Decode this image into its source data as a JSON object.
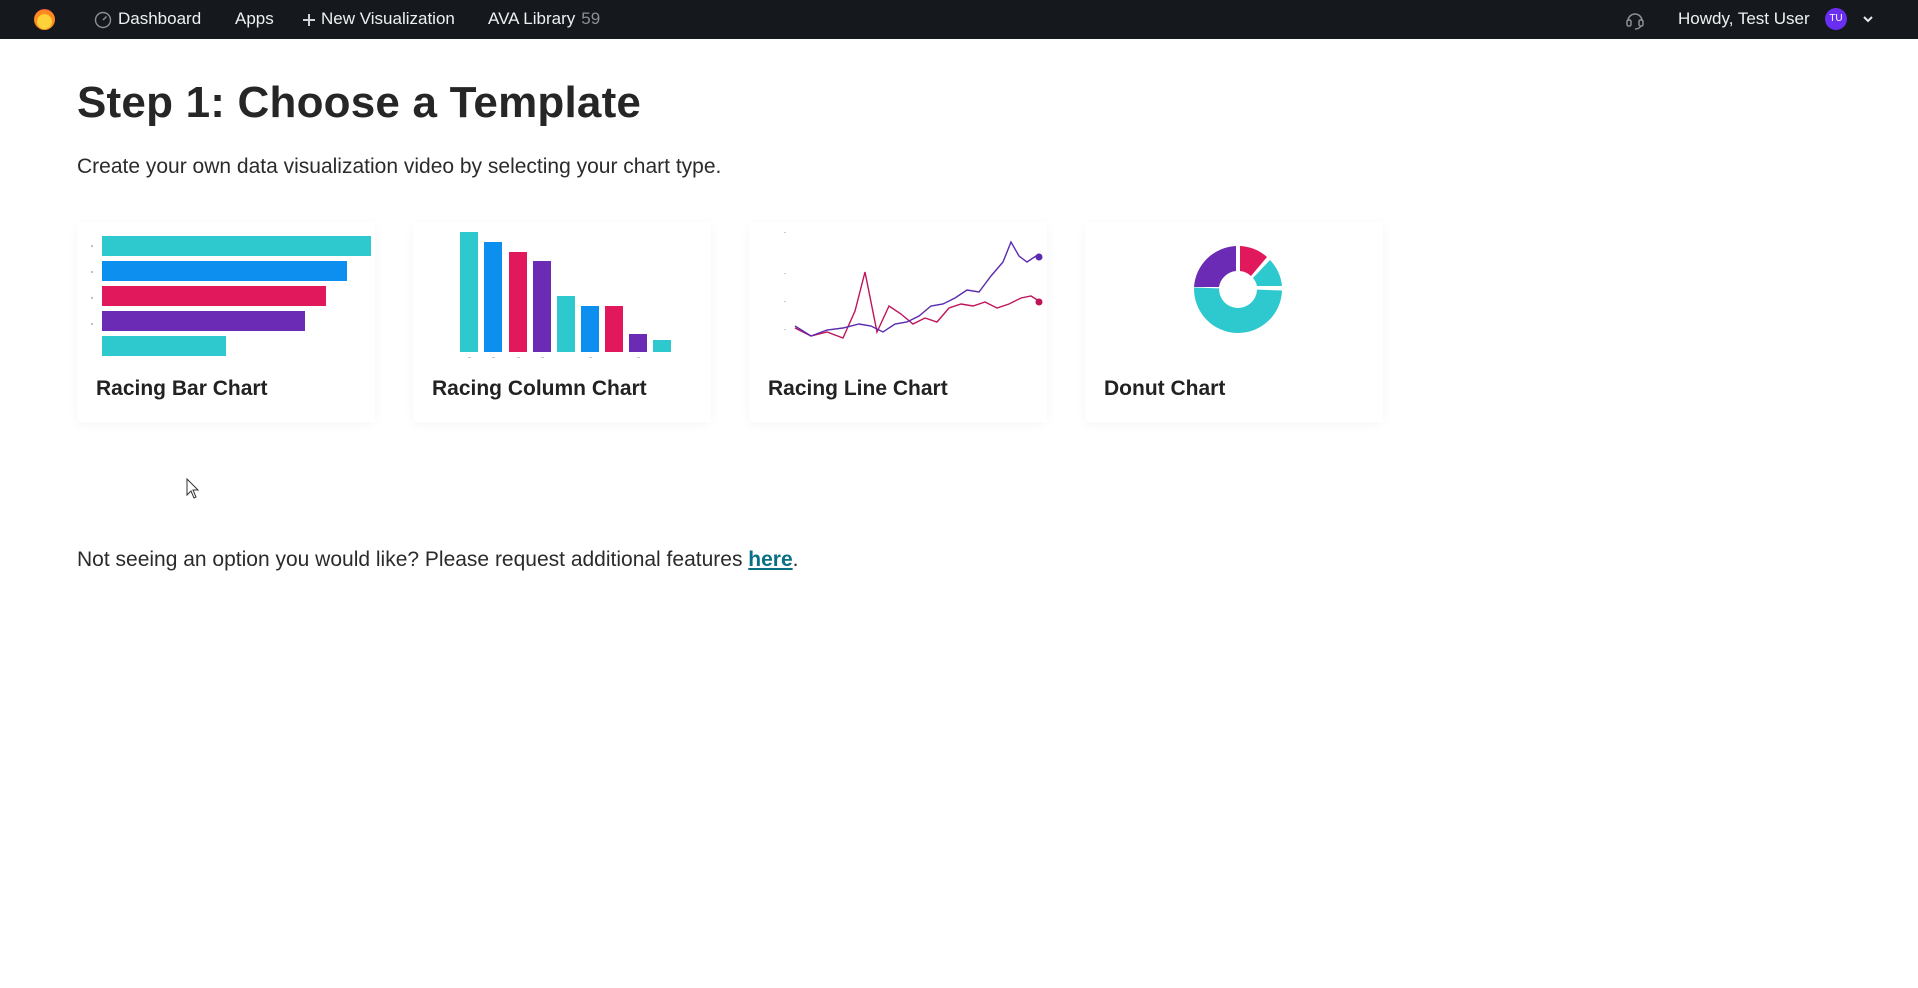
{
  "topbar": {
    "nav": [
      {
        "label": "Dashboard",
        "icon": "gauge-icon"
      },
      {
        "label": "Apps"
      },
      {
        "label": "New Visualization",
        "icon": "plus-icon"
      },
      {
        "label": "AVA Library",
        "count": "59"
      }
    ],
    "help_icon": "support-headset-icon",
    "greeting": "Howdy, Test User",
    "avatar_initials": "TU",
    "avatar_color": "#6a2df2"
  },
  "main": {
    "title": "Step 1: Choose a Template",
    "subtitle": "Create your own data visualization video by selecting your chart type.",
    "templates": [
      {
        "label": "Racing Bar Chart",
        "thumbnail": "racing-bar-thumbnail"
      },
      {
        "label": "Racing Column Chart",
        "thumbnail": "racing-column-thumbnail"
      },
      {
        "label": "Racing Line Chart",
        "thumbnail": "racing-line-thumbnail"
      },
      {
        "label": "Donut Chart",
        "thumbnail": "donut-thumbnail"
      }
    ],
    "footer_text": "Not seeing an option you would like? Please request additional features ",
    "footer_link": "here",
    "footer_end": "."
  },
  "colors": {
    "topbar_bg": "#15191e",
    "teal": "#2ec8cf",
    "blue": "#0d8ff0",
    "magenta": "#e2185c",
    "purple": "#6b2bb4",
    "link": "#0a6f86"
  }
}
